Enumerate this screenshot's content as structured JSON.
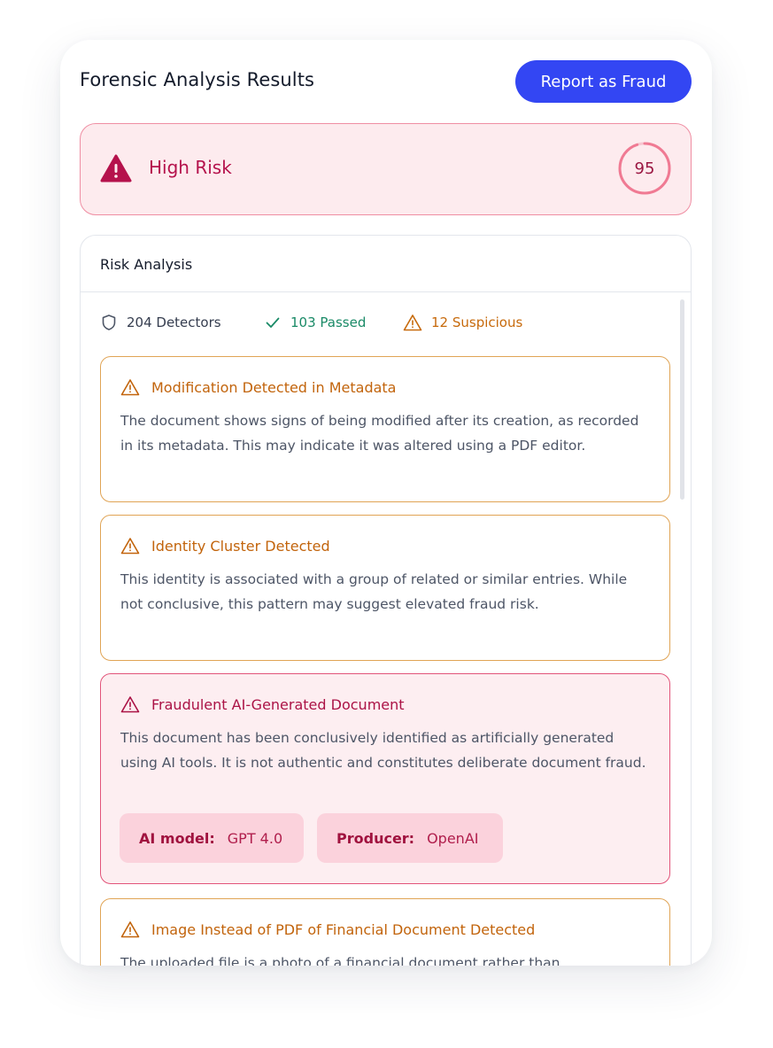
{
  "header": {
    "title": "Forensic Analysis Results",
    "report_button": "Report as Fraud"
  },
  "risk": {
    "level": "High Risk",
    "score": "95",
    "score_value": 95
  },
  "panel": {
    "title": "Risk Analysis",
    "stats": {
      "detectors": "204 Detectors",
      "passed": "103 Passed",
      "suspicious": "12 Suspicious"
    },
    "findings": [
      {
        "severity": "warning",
        "title": "Modification Detected in Metadata",
        "description": "The document shows signs of being modified after its creation, as recorded in its metadata. This may indicate it was altered using a PDF editor."
      },
      {
        "severity": "warning",
        "title": "Identity Cluster Detected",
        "description": "This identity is associated with a group of related or similar entries. While not conclusive, this pattern may suggest elevated fraud risk."
      },
      {
        "severity": "critical",
        "title": "Fraudulent AI-Generated Document",
        "description": "This document has been conclusively identified as artificially generated using AI tools. It is not authentic and constitutes deliberate document fraud.",
        "chips": [
          {
            "key": "AI model:",
            "value": "GPT 4.0"
          },
          {
            "key": "Producer:",
            "value": "OpenAI"
          }
        ]
      },
      {
        "severity": "warning",
        "title": "Image Instead of PDF of Financial Document Detected",
        "description": "The uploaded file is a photo of a financial document rather than"
      }
    ]
  },
  "colors": {
    "brand_button": "#3346f3",
    "high_risk": "#b5124c",
    "warning": "#c2640c",
    "passed": "#1a8a67"
  }
}
